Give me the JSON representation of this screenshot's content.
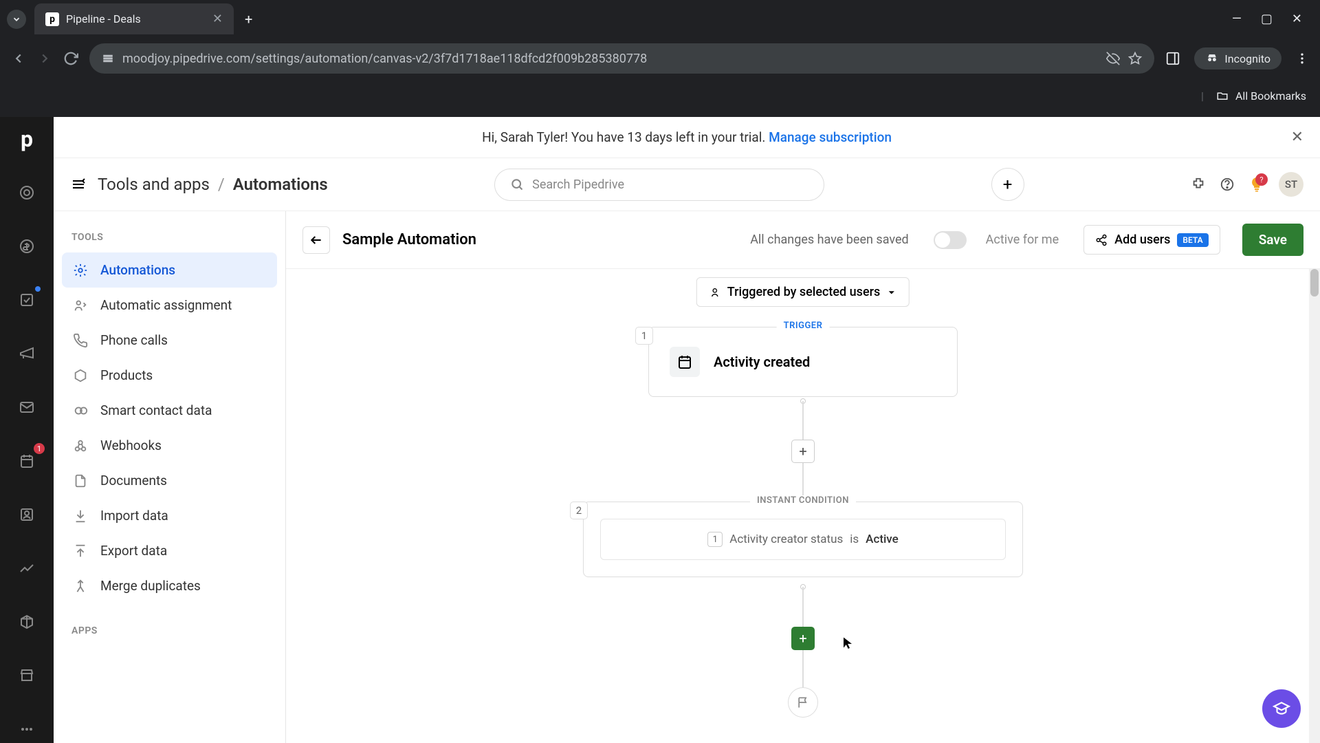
{
  "browser": {
    "tab_title": "Pipeline - Deals",
    "url": "moodjoy.pipedrive.com/settings/automation/canvas-v2/3f7d1718ae118dfcd2f009b285380778",
    "incognito": "Incognito",
    "all_bookmarks": "All Bookmarks"
  },
  "banner": {
    "text_prefix": "Hi, Sarah Tyler! You have 13 days left in your trial. ",
    "link": "Manage subscription"
  },
  "breadcrumb": {
    "parent": "Tools and apps",
    "current": "Automations"
  },
  "search": {
    "placeholder": "Search Pipedrive"
  },
  "avatar": "ST",
  "help_badge": "?",
  "rail_badge": "1",
  "sidebar": {
    "tools_heading": "TOOLS",
    "apps_heading": "APPS",
    "items": [
      {
        "label": "Automations"
      },
      {
        "label": "Automatic assignment"
      },
      {
        "label": "Phone calls"
      },
      {
        "label": "Products"
      },
      {
        "label": "Smart contact data"
      },
      {
        "label": "Webhooks"
      },
      {
        "label": "Documents"
      },
      {
        "label": "Import data"
      },
      {
        "label": "Export data"
      },
      {
        "label": "Merge duplicates"
      }
    ]
  },
  "header": {
    "title": "Sample Automation",
    "status": "All changes have been saved",
    "toggle_label": "Active for me",
    "add_users": "Add users",
    "beta": "BETA",
    "save": "Save"
  },
  "canvas": {
    "trigger_users": "Triggered by selected users",
    "node1": {
      "num": "1",
      "label": "TRIGGER",
      "title": "Activity created"
    },
    "node2": {
      "num": "2",
      "label": "INSTANT CONDITION",
      "cond_idx": "1",
      "field": "Activity creator status",
      "op": "is",
      "value": "Active"
    }
  }
}
